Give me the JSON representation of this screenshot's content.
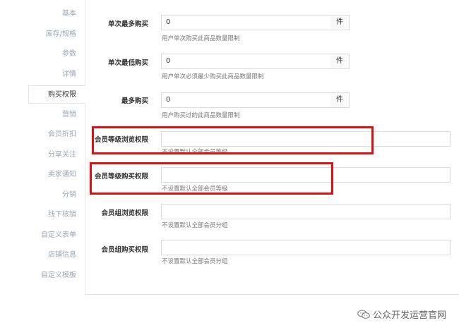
{
  "sidebar": {
    "items": [
      {
        "label": "基本"
      },
      {
        "label": "库存/规格"
      },
      {
        "label": "参数"
      },
      {
        "label": "详情"
      },
      {
        "label": "购买权限",
        "active": true
      },
      {
        "label": "营销"
      },
      {
        "label": "会员折扣"
      },
      {
        "label": "分享关注"
      },
      {
        "label": "卖家通知"
      },
      {
        "label": "分销"
      },
      {
        "label": "线下核销"
      },
      {
        "label": "自定义表单"
      },
      {
        "label": "店铺信息"
      },
      {
        "label": "自定义模板"
      }
    ]
  },
  "form": {
    "max_per_order": {
      "label": "单次最多购买",
      "value": "0",
      "unit": "件",
      "help": "用户单次购买此商品数量限制"
    },
    "min_per_order": {
      "label": "单次最低购买",
      "value": "0",
      "unit": "件",
      "help": "用户单次必须最少购买此商品数量限制"
    },
    "max_total": {
      "label": "最多购买",
      "value": "0",
      "unit": "件",
      "help": "用户购买过的此商品数量限制"
    },
    "level_browse": {
      "label": "会员等级浏览权限",
      "value": "",
      "help": "不设置默认全部会员等级"
    },
    "level_buy": {
      "label": "会员等级购买权限",
      "value": "",
      "help": "不设置默认全部会员等级"
    },
    "group_browse": {
      "label": "会员组浏览权限",
      "value": "",
      "help": "不设置默认全部会员分组"
    },
    "group_buy": {
      "label": "会员组购买权限",
      "value": "",
      "help": "不设置默认全部会员分组"
    }
  },
  "watermark": {
    "text": "公众开发运营官网",
    "icon": "wechat-icon"
  },
  "colors": {
    "highlight": "#e01010",
    "sidebar_text": "#9aa6b2",
    "border": "#dcdcdc"
  }
}
